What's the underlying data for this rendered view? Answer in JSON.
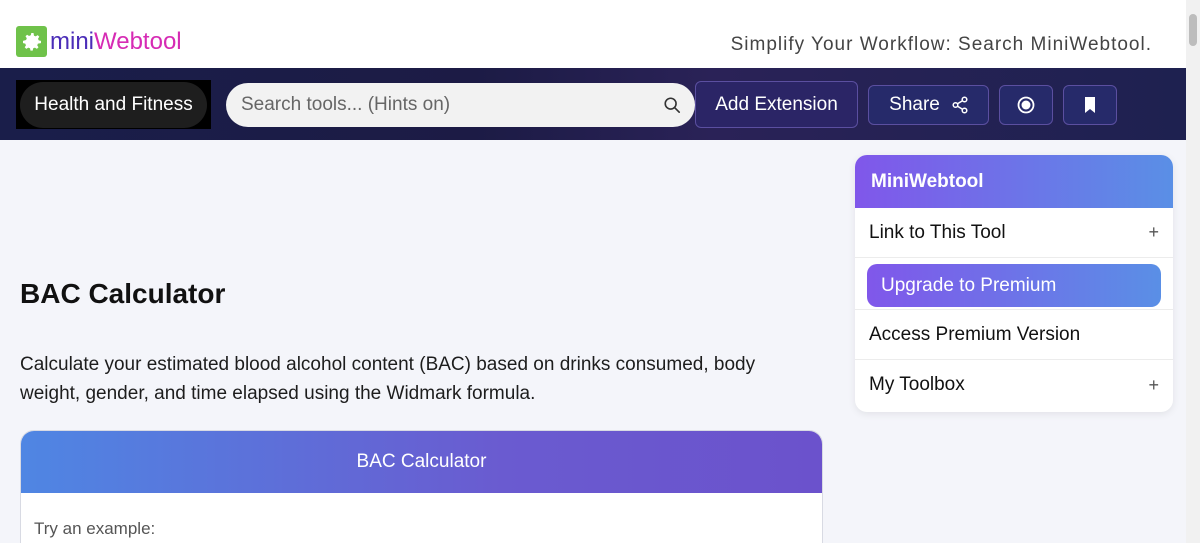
{
  "header": {
    "logo_mini": "mini",
    "logo_webtool": "Webtool",
    "tagline": "Simplify Your Workflow: Search MiniWebtool."
  },
  "nav": {
    "category": "Health and Fitness",
    "search_placeholder": "Search tools... (Hints on)",
    "add_extension": "Add Extension",
    "share": "Share"
  },
  "main": {
    "title": "BAC Calculator",
    "description": "Calculate your estimated blood alcohol content (BAC) based on drinks consumed, body weight, gender, and time elapsed using the Widmark formula.",
    "card_title": "BAC Calculator",
    "example_label": "Try an example:"
  },
  "sidebar": {
    "title": "MiniWebtool",
    "items": [
      {
        "label": "Link to This Tool",
        "expand": "+"
      },
      {
        "label": "Upgrade to Premium"
      },
      {
        "label": "Access Premium Version"
      },
      {
        "label": "My Toolbox",
        "expand": "+"
      }
    ]
  },
  "colors": {
    "logo_green": "#6fc24a",
    "logo_purple": "#4b2db8",
    "logo_magenta": "#d62bb4",
    "navbar": "#1c1b45",
    "accent_gradient_start": "#8057ea",
    "accent_gradient_end": "#5a8fe6"
  },
  "icons": [
    "gear-icon",
    "search-icon",
    "share-icon",
    "record-icon",
    "bookmark-icon"
  ]
}
